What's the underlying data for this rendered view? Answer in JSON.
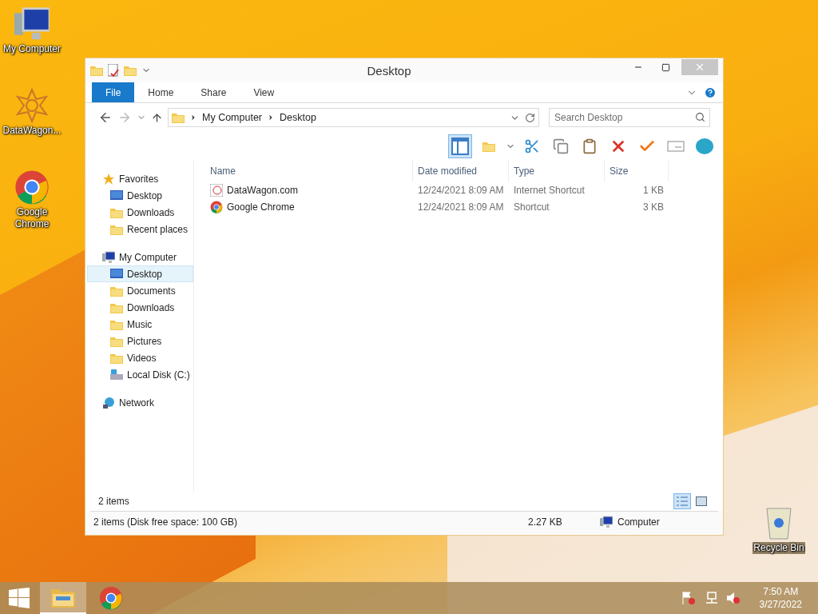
{
  "desktop_icons": [
    {
      "label": "My Computer",
      "kind": "computer"
    },
    {
      "label": "DataWagon...",
      "kind": "star"
    },
    {
      "label": "Google Chrome",
      "kind": "chrome"
    }
  ],
  "recycle_bin": {
    "label": "Recycle Bin"
  },
  "window": {
    "title": "Desktop",
    "ribbon_tabs": [
      {
        "label": "File",
        "kind": "file"
      },
      {
        "label": "Home",
        "kind": "tab"
      },
      {
        "label": "Share",
        "kind": "tab"
      },
      {
        "label": "View",
        "kind": "tab"
      }
    ],
    "breadcrumbs": [
      "My Computer",
      "Desktop"
    ],
    "search": {
      "placeholder": "Search Desktop"
    },
    "preview_pane": {
      "selected": true
    },
    "nav": [
      {
        "label": "Favorites",
        "kind": "star",
        "selected": false,
        "children": [
          {
            "label": "Desktop",
            "kind": "desktop",
            "selected": false
          },
          {
            "label": "Downloads",
            "kind": "downloads",
            "selected": false
          },
          {
            "label": "Recent places",
            "kind": "recent",
            "selected": false
          }
        ]
      },
      {
        "label": "My Computer",
        "kind": "computer",
        "selected": false,
        "children": [
          {
            "label": "Desktop",
            "kind": "desktop",
            "selected": true
          },
          {
            "label": "Documents",
            "kind": "folder",
            "selected": false
          },
          {
            "label": "Downloads",
            "kind": "downloads",
            "selected": false
          },
          {
            "label": "Music",
            "kind": "folder",
            "selected": false
          },
          {
            "label": "Pictures",
            "kind": "folder",
            "selected": false
          },
          {
            "label": "Videos",
            "kind": "folder",
            "selected": false
          },
          {
            "label": "Local Disk (C:)",
            "kind": "disk",
            "selected": false
          }
        ]
      },
      {
        "label": "Network",
        "kind": "network",
        "selected": false
      }
    ],
    "columns": [
      "Name",
      "Date modified",
      "Type",
      "Size"
    ],
    "rows": [
      {
        "name": "DataWagon.com",
        "kind": "url",
        "date": "12/24/2021 8:09 AM",
        "type": "Internet Shortcut",
        "size": "1 KB"
      },
      {
        "name": "Google Chrome",
        "kind": "chrome",
        "date": "12/24/2021 8:09 AM",
        "type": "Shortcut",
        "size": "3 KB"
      }
    ],
    "item_count": "2 items",
    "views": [
      {
        "kind": "details",
        "selected": true
      },
      {
        "kind": "large",
        "selected": false
      }
    ],
    "status_bar": {
      "summary": "2 items (Disk free space: 100 GB)",
      "size": "2.27 KB",
      "location": "Computer"
    }
  },
  "taskbar": {
    "apps": [
      {
        "kind": "explorer",
        "selected": true
      },
      {
        "kind": "chrome",
        "selected": false
      }
    ],
    "time": "7:50 AM",
    "date": "3/27/2022"
  }
}
